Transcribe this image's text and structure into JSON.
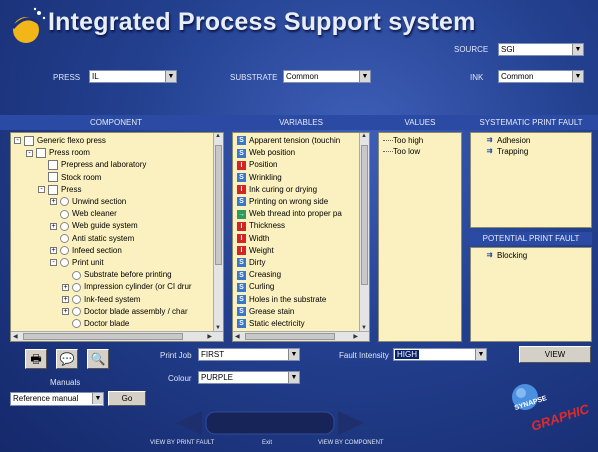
{
  "app": {
    "title": "Integrated Process Support system"
  },
  "filters": {
    "source_label": "SOURCE",
    "source_value": "SGI",
    "press_label": "PRESS",
    "press_value": "IL",
    "substrate_label": "SUBSTRATE",
    "substrate_value": "Common",
    "ink_label": "INK",
    "ink_value": "Common"
  },
  "headers": {
    "component": "COMPONENT",
    "variables": "VARIABLES",
    "values": "VALUES",
    "systematic": "SYSTEMATIC PRINT FAULT",
    "potential": "POTENTIAL PRINT FAULT"
  },
  "component_tree": [
    {
      "label": "Generic flexo press",
      "toggle": "-",
      "indent": 0,
      "node": "box"
    },
    {
      "label": "Press room",
      "toggle": "-",
      "indent": 1,
      "node": "box"
    },
    {
      "label": "Prepress and laboratory",
      "toggle": "",
      "indent": 2,
      "node": "box"
    },
    {
      "label": "Stock room",
      "toggle": "",
      "indent": 2,
      "node": "box"
    },
    {
      "label": "Press",
      "toggle": "-",
      "indent": 2,
      "node": "box"
    },
    {
      "label": "Unwind section",
      "toggle": "+",
      "indent": 3,
      "node": "circle"
    },
    {
      "label": "Web cleaner",
      "toggle": "",
      "indent": 3,
      "node": "circle"
    },
    {
      "label": "Web guide system",
      "toggle": "+",
      "indent": 3,
      "node": "circle"
    },
    {
      "label": "Anti static system",
      "toggle": "",
      "indent": 3,
      "node": "circle"
    },
    {
      "label": "Infeed section",
      "toggle": "+",
      "indent": 3,
      "node": "circle"
    },
    {
      "label": "Print unit",
      "toggle": "-",
      "indent": 3,
      "node": "circle"
    },
    {
      "label": "Substrate before printing",
      "toggle": "",
      "indent": 4,
      "node": "circle"
    },
    {
      "label": "Impression cylinder (or CI drur",
      "toggle": "+",
      "indent": 4,
      "node": "circle"
    },
    {
      "label": "Ink-feed system",
      "toggle": "+",
      "indent": 4,
      "node": "circle"
    },
    {
      "label": "Doctor blade assembly / char",
      "toggle": "+",
      "indent": 4,
      "node": "circle"
    },
    {
      "label": "Doctor blade",
      "toggle": "",
      "indent": 4,
      "node": "circle"
    }
  ],
  "variables": [
    {
      "label": "Apparent tension (touchin",
      "icon": "blue"
    },
    {
      "label": "Web position",
      "icon": "blue"
    },
    {
      "label": "Position",
      "icon": "red"
    },
    {
      "label": "Wrinkling",
      "icon": "blue"
    },
    {
      "label": "Ink curing or drying",
      "icon": "red"
    },
    {
      "label": "Printing on wrong side",
      "icon": "blue"
    },
    {
      "label": "Web thread into proper pa",
      "icon": "green"
    },
    {
      "label": "Thickness",
      "icon": "red"
    },
    {
      "label": "Width",
      "icon": "red"
    },
    {
      "label": "Weight",
      "icon": "red"
    },
    {
      "label": "Dirty",
      "icon": "blue"
    },
    {
      "label": "Creasing",
      "icon": "blue"
    },
    {
      "label": "Curling",
      "icon": "blue"
    },
    {
      "label": "Holes in the substrate",
      "icon": "blue"
    },
    {
      "label": "Grease stain",
      "icon": "blue"
    },
    {
      "label": "Static electricity",
      "icon": "blue"
    }
  ],
  "values_list": [
    "Too high",
    "Too low"
  ],
  "systematic_faults": [
    "Adhesion",
    "Trapping"
  ],
  "potential_faults": [
    "Blocking"
  ],
  "bottom": {
    "manuals_label": "Manuals",
    "manual_select": "Reference manual",
    "go_label": "Go",
    "print_job_label": "Print Job",
    "print_job_value": "FIRST",
    "colour_label": "Colour",
    "colour_value": "PURPLE",
    "fault_intensity_label": "Fault Intensity",
    "fault_intensity_value": "HIGH",
    "view_label": "VIEW",
    "nav_left": "VIEW BY PRINT FAULT",
    "nav_center": "Exit",
    "nav_right": "VIEW BY COMPONENT",
    "brand_line1": "SYNAPSE",
    "brand_line2": "GRAPHIC"
  },
  "colors": {
    "background": "#23408f",
    "panel": "#fbf1c0",
    "band": "#2b4aa3"
  }
}
